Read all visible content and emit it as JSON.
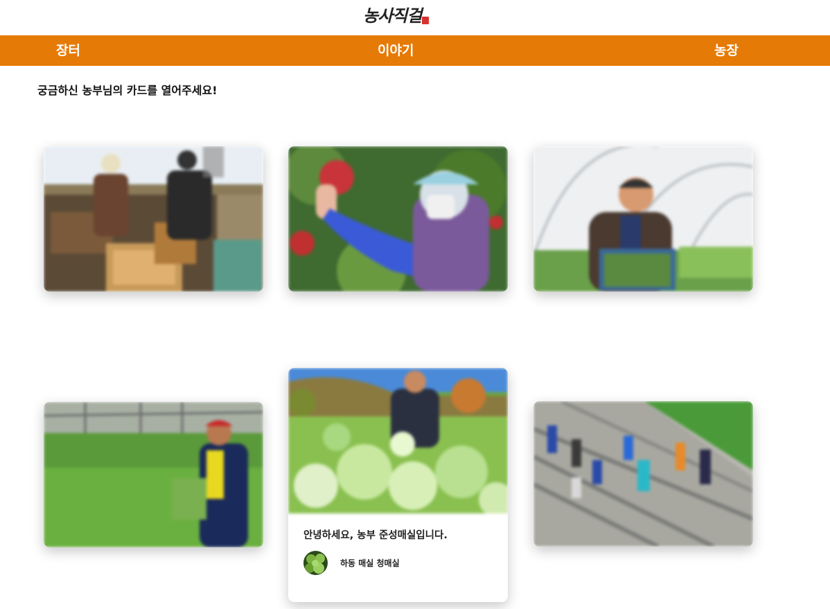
{
  "site": {
    "logo_text": "농사직걸"
  },
  "nav": {
    "items": [
      {
        "label": "장터"
      },
      {
        "label": "이야기"
      },
      {
        "label": "농장"
      }
    ]
  },
  "intro": {
    "text": "궁금하신 농부님의 카드를 열어주세요!"
  },
  "cards": [
    {
      "scene": "beekeepers-with-hive-frames",
      "expanded": false
    },
    {
      "scene": "woman-picking-apple",
      "expanded": false
    },
    {
      "scene": "farmer-in-greenhouse-holding-crate",
      "expanded": false
    },
    {
      "scene": "farmer-in-greenhouse-field",
      "expanded": false
    },
    {
      "scene": "farmer-harvesting-cabbage",
      "expanded": true,
      "greeting": "안녕하세요, 농부 준성매실입니다.",
      "farm_name": "하동 매실 청매실",
      "avatar": "green-plum-avatar"
    },
    {
      "scene": "group-waving-on-sloped-field",
      "expanded": false
    }
  ],
  "colors": {
    "nav_bg": "#e67a06",
    "nav_text": "#ffffff",
    "logo_seal": "#d9312f"
  }
}
